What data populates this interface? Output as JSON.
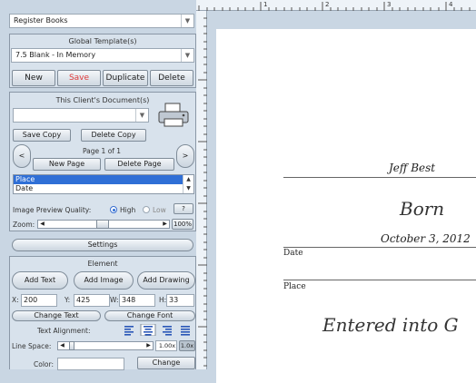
{
  "register_select": "Register Books",
  "global_templates": {
    "title": "Global Template(s)",
    "selected": "7.5 Blank - In Memory",
    "new": "New",
    "save": "Save",
    "duplicate": "Duplicate",
    "delete": "Delete"
  },
  "client_docs": {
    "title": "This Client's Document(s)",
    "selected": "",
    "save_copy": "Save Copy",
    "delete_copy": "Delete Copy",
    "page_label": "Page 1 of 1",
    "new_page": "New Page",
    "delete_page": "Delete Page",
    "list": [
      "Place",
      "Date"
    ],
    "quality_label": "Image Preview Quality:",
    "quality_high": "High",
    "quality_low": "Low",
    "quality_help": "?",
    "zoom_label": "Zoom:",
    "zoom_value": "100%",
    "settings": "Settings"
  },
  "element": {
    "title": "Element",
    "add_text": "Add Text",
    "add_image": "Add Image",
    "add_drawing": "Add Drawing",
    "x_label": "X:",
    "x": "200",
    "y_label": "Y:",
    "y": "425",
    "w_label": "W:",
    "w": "348",
    "h_label": "H:",
    "h": "33",
    "change_text": "Change Text",
    "change_font": "Change Font",
    "text_alignment": "Text Alignment:",
    "line_space_label": "Line Space:",
    "line_space_value": "1.00x",
    "line_space_reset": "1.0x",
    "color_label": "Color:",
    "change_color": "Change"
  },
  "ruler": {
    "marks": [
      "1",
      "2",
      "3",
      "4"
    ]
  },
  "document": {
    "name": "Jeff Best",
    "born": "Born",
    "born_date": "October 3, 2012",
    "date_label": "Date",
    "place_label": "Place",
    "entered": "Entered into G"
  }
}
